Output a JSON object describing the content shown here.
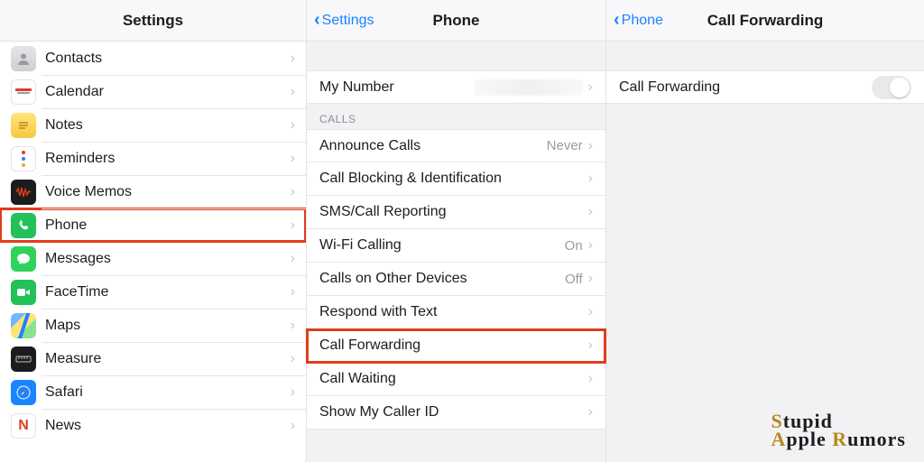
{
  "left": {
    "title": "Settings",
    "items": [
      {
        "label": "Contacts",
        "icon": "contacts-icon"
      },
      {
        "label": "Calendar",
        "icon": "calendar-icon"
      },
      {
        "label": "Notes",
        "icon": "notes-icon"
      },
      {
        "label": "Reminders",
        "icon": "reminders-icon"
      },
      {
        "label": "Voice Memos",
        "icon": "voice-memos-icon"
      },
      {
        "label": "Phone",
        "icon": "phone-icon"
      },
      {
        "label": "Messages",
        "icon": "messages-icon"
      },
      {
        "label": "FaceTime",
        "icon": "facetime-icon"
      },
      {
        "label": "Maps",
        "icon": "maps-icon"
      },
      {
        "label": "Measure",
        "icon": "measure-icon"
      },
      {
        "label": "Safari",
        "icon": "safari-icon"
      },
      {
        "label": "News",
        "icon": "news-icon"
      }
    ],
    "highlighted_label": "Phone"
  },
  "middle": {
    "back_label": "Settings",
    "title": "Phone",
    "my_number_label": "My Number",
    "group_label": "CALLS",
    "rows": [
      {
        "label": "Announce Calls",
        "value": "Never"
      },
      {
        "label": "Call Blocking & Identification",
        "value": ""
      },
      {
        "label": "SMS/Call Reporting",
        "value": ""
      },
      {
        "label": "Wi-Fi Calling",
        "value": "On"
      },
      {
        "label": "Calls on Other Devices",
        "value": "Off"
      },
      {
        "label": "Respond with Text",
        "value": ""
      },
      {
        "label": "Call Forwarding",
        "value": ""
      },
      {
        "label": "Call Waiting",
        "value": ""
      },
      {
        "label": "Show My Caller ID",
        "value": ""
      }
    ],
    "highlighted_label": "Call Forwarding"
  },
  "right": {
    "back_label": "Phone",
    "title": "Call Forwarding",
    "row_label": "Call Forwarding",
    "switch_on": false
  },
  "watermark": {
    "line1_gold": "S",
    "line1_rest": "tupid",
    "line2_gold_a": "A",
    "line2_mid": "pple ",
    "line2_gold_r": "R",
    "line2_rest": "umors"
  }
}
